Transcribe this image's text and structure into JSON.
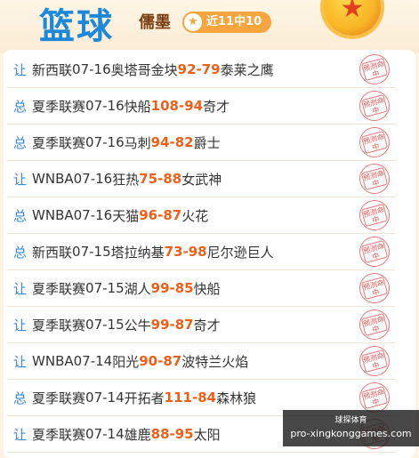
{
  "header": {
    "title": "篮球",
    "expert_name": "儒墨",
    "streak_label": "近11中10"
  },
  "icons": {
    "streak_icon": "star-badge-icon",
    "medal_icon": "gold-medal-icon",
    "stamp_icon": "prediction-hit-stamp-icon"
  },
  "colors": {
    "title": "#1e88d8",
    "tag": "#3a88d8",
    "score": "#ef5f17",
    "streak_bg": "#f7a53f",
    "stamp": "#e05555"
  },
  "stamp_text": "预测命中",
  "predictions": [
    {
      "tag": "让",
      "league": "新西联",
      "date": "07-16",
      "home": "奥塔哥金块",
      "home_score": "92",
      "away_score": "79",
      "away": "泰莱之鹰"
    },
    {
      "tag": "总",
      "league": "夏季联赛",
      "date": "07-16",
      "home": "快船",
      "home_score": "108",
      "away_score": "94",
      "away": "奇才"
    },
    {
      "tag": "总",
      "league": "夏季联赛",
      "date": "07-16",
      "home": "马刺",
      "home_score": "94",
      "away_score": "82",
      "away": "爵士"
    },
    {
      "tag": "让",
      "league": "WNBA",
      "date": "07-16",
      "home": "狂热",
      "home_score": "75",
      "away_score": "88",
      "away": "女武神"
    },
    {
      "tag": "总",
      "league": "WNBA",
      "date": "07-16",
      "home": "天猫",
      "home_score": "96",
      "away_score": "87",
      "away": "火花"
    },
    {
      "tag": "总",
      "league": "新西联",
      "date": "07-15",
      "home": "塔拉纳基",
      "home_score": "73",
      "away_score": "98",
      "away": "尼尔逊巨人"
    },
    {
      "tag": "让",
      "league": "夏季联赛",
      "date": "07-15",
      "home": "湖人",
      "home_score": "99",
      "away_score": "85",
      "away": "快船"
    },
    {
      "tag": "让",
      "league": "夏季联赛",
      "date": "07-15",
      "home": "公牛",
      "home_score": "99",
      "away_score": "87",
      "away": "奇才"
    },
    {
      "tag": "让",
      "league": "WNBA",
      "date": "07-14",
      "home": "阳光",
      "home_score": "90",
      "away_score": "87",
      "away": "波特兰火焰"
    },
    {
      "tag": "总",
      "league": "夏季联赛",
      "date": "07-14",
      "home": "开拓者",
      "home_score": "111",
      "away_score": "84",
      "away": "森林狼"
    },
    {
      "tag": "让",
      "league": "夏季联赛",
      "date": "07-14",
      "home": "雄鹿",
      "home_score": "88",
      "away_score": "95",
      "away": "太阳"
    }
  ],
  "watermark": {
    "top": "球探体育",
    "url": "pro-xingkonggames.com"
  }
}
